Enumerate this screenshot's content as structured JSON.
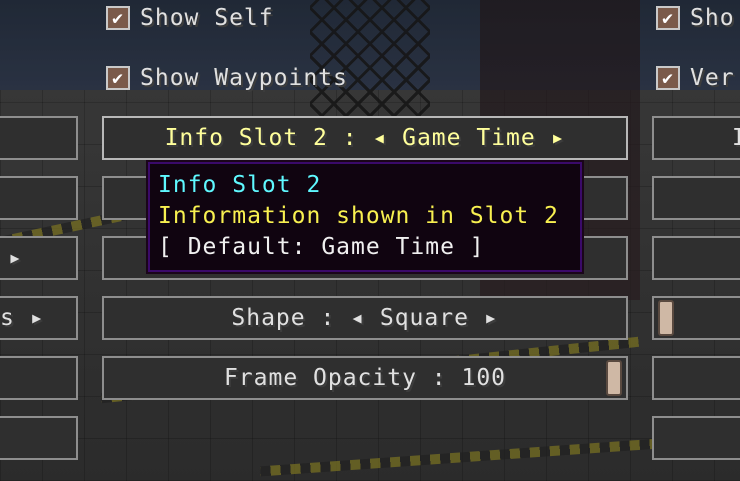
{
  "checkboxes": {
    "show_self": {
      "label": "Show Self",
      "checked": "✔"
    },
    "show_waypoints": {
      "label": "Show Waypoints",
      "checked": "✔"
    },
    "right_1": {
      "label": "Sho",
      "checked": "✔"
    },
    "right_2": {
      "label": "Ver",
      "checked": "✔"
    }
  },
  "center_buttons": {
    "info_slot_2": "Info Slot 2 : ◂ Game Time ▸",
    "hidden_row_1": "",
    "hidden_row_2": "",
    "shape": "Shape : ◂ Square ▸",
    "frame_opacity": "Frame Opacity : 100"
  },
  "frame_opacity": {
    "value": 100,
    "min": 0,
    "max": 100
  },
  "left_buttons": {
    "row_3_fragment": "▸",
    "row_4_fragment": "s ▸"
  },
  "right_buttons": {
    "row_1_fragment": "I"
  },
  "tooltip": {
    "title": "Info Slot 2",
    "description": "Information shown in Slot 2",
    "default": "[ Default: Game Time ]"
  },
  "colors": {
    "tooltip_title": "#5ff8ff",
    "tooltip_description": "#f8f050",
    "hover_text": "#ffff9b"
  }
}
